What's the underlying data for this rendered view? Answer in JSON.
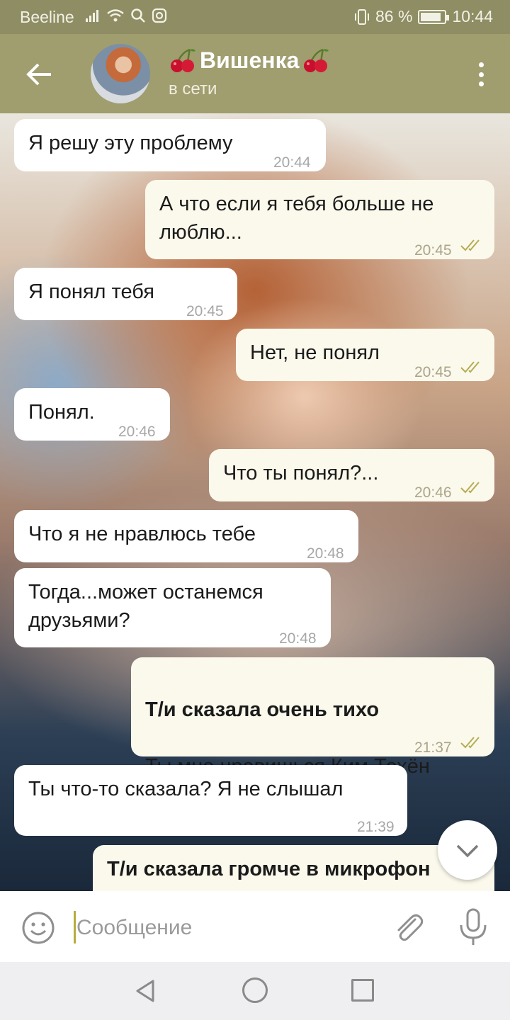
{
  "status_bar": {
    "carrier": "Beeline",
    "battery": "86 %",
    "battery_level": 0.86,
    "time": "10:44"
  },
  "header": {
    "name": "Вишенка",
    "status": "в сети",
    "decoration_icon": "cherry-icon"
  },
  "messages": [
    {
      "dir": "in",
      "text": "Я решу эту проблему",
      "time": "20:44"
    },
    {
      "dir": "out",
      "text": "А что если я тебя больше не люблю...",
      "time": "20:45",
      "read": true
    },
    {
      "dir": "in",
      "text": "Я понял тебя",
      "time": "20:45"
    },
    {
      "dir": "out",
      "text": "Нет, не понял",
      "time": "20:45",
      "read": true
    },
    {
      "dir": "in",
      "text": "Понял.",
      "time": "20:46"
    },
    {
      "dir": "out",
      "text": "Что ты понял?...",
      "time": "20:46",
      "read": true
    },
    {
      "dir": "in",
      "text": "Что я не нравлюсь тебе",
      "time": "20:48"
    },
    {
      "dir": "in",
      "text": "Тогда...может останемся друзьями?",
      "time": "20:48"
    },
    {
      "dir": "out",
      "bold": "Т/и сказала очень тихо",
      "text": "Ты мне нравишься Ким Тэхён",
      "time": "21:37",
      "read": true
    },
    {
      "dir": "in",
      "text": "Ты что-то сказала? Я не слышал",
      "time": "21:39"
    },
    {
      "dir": "out",
      "bold": "Т/и сказала громче в микрофон"
    }
  ],
  "input": {
    "placeholder": "Сообщение"
  },
  "colors": {
    "header": "#a09d6f",
    "status_bar": "#8f8d63",
    "bubble_in": "#ffffff",
    "bubble_out": "#fbf9ec",
    "read_ticks": "#b5ad55"
  }
}
